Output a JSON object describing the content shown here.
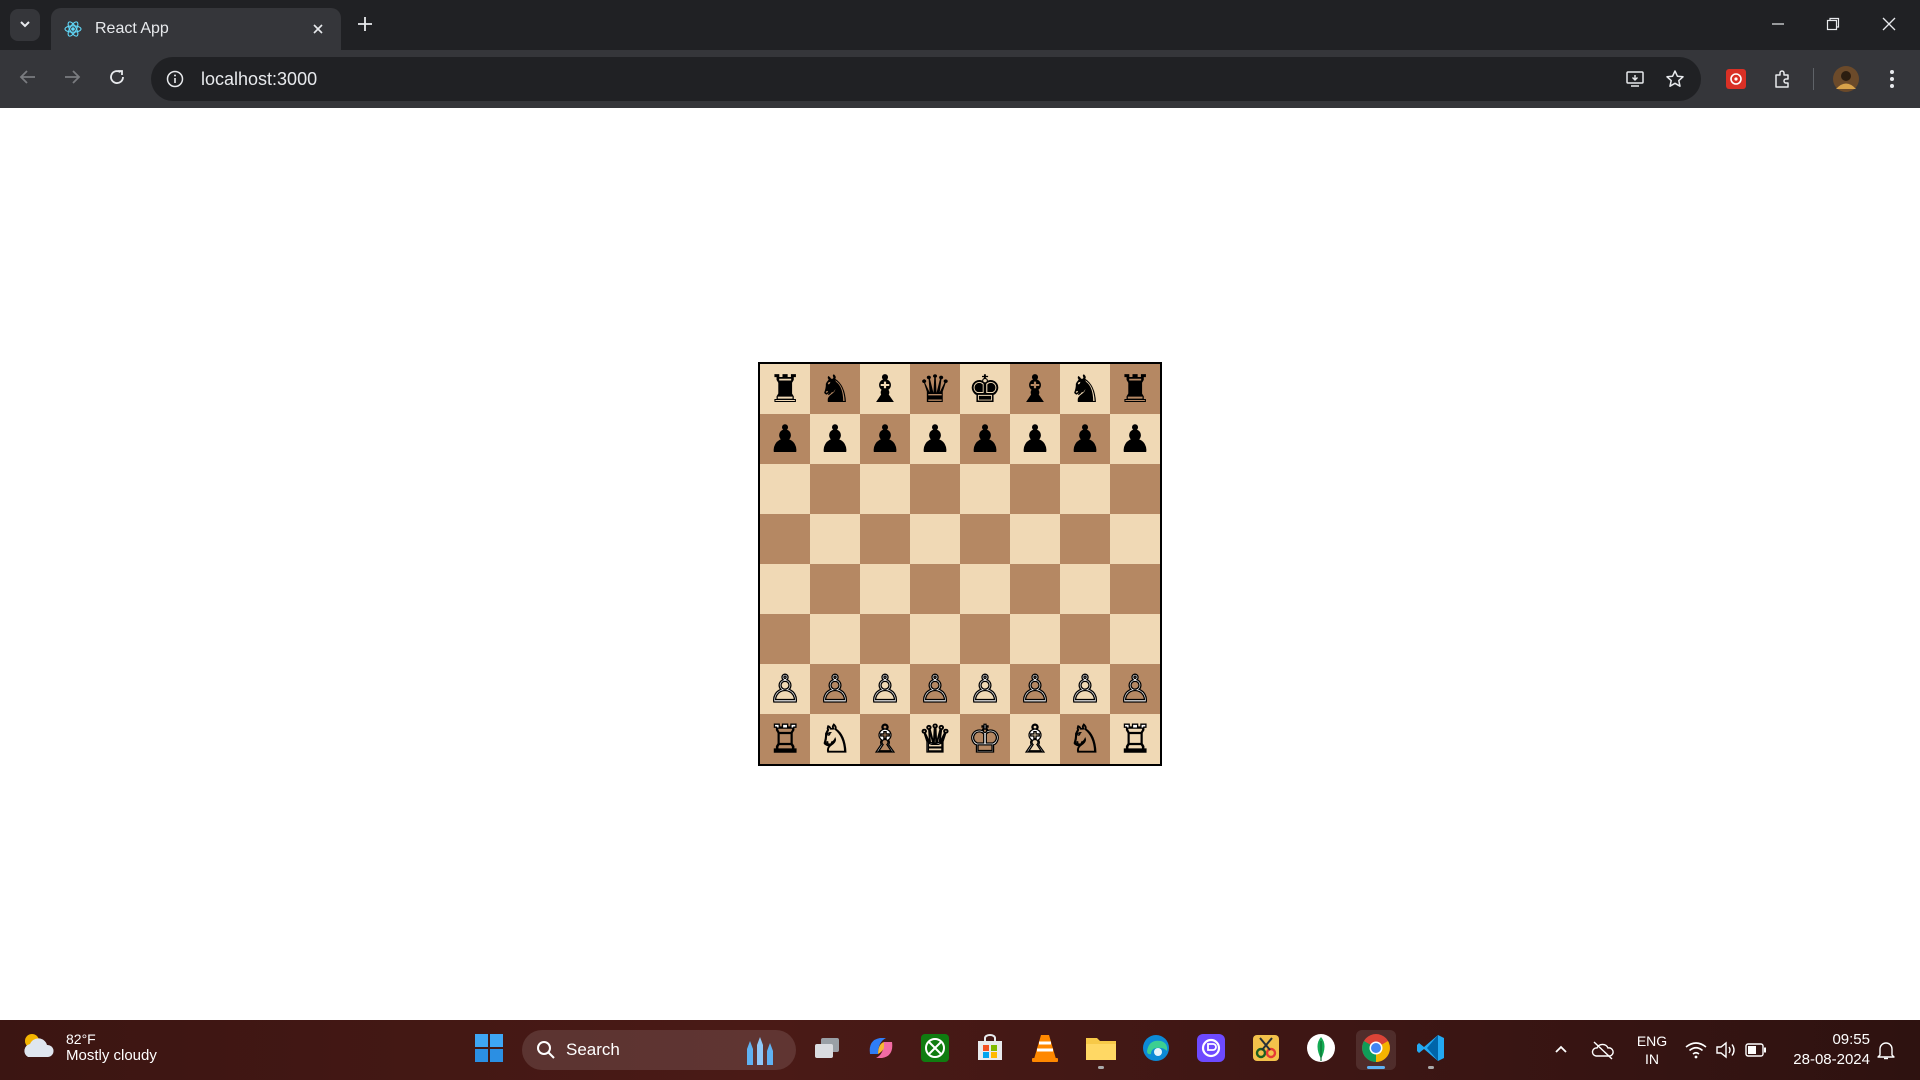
{
  "browser": {
    "tab": {
      "title": "React App",
      "favicon": "react-icon"
    },
    "address": {
      "url": "localhost:3000"
    }
  },
  "board": {
    "light_color": "#f0d9b5",
    "dark_color": "#b58863",
    "rows": [
      [
        "♜",
        "♞",
        "♝",
        "♛",
        "♚",
        "♝",
        "♞",
        "♜"
      ],
      [
        "♟",
        "♟",
        "♟",
        "♟",
        "♟",
        "♟",
        "♟",
        "♟"
      ],
      [
        "",
        "",
        "",
        "",
        "",
        "",
        "",
        ""
      ],
      [
        "",
        "",
        "",
        "",
        "",
        "",
        "",
        ""
      ],
      [
        "",
        "",
        "",
        "",
        "",
        "",
        "",
        ""
      ],
      [
        "",
        "",
        "",
        "",
        "",
        "",
        "",
        ""
      ],
      [
        "♙",
        "♙",
        "♙",
        "♙",
        "♙",
        "♙",
        "♙",
        "♙"
      ],
      [
        "♖",
        "♘",
        "♗",
        "♕",
        "♔",
        "♗",
        "♘",
        "♖"
      ]
    ]
  },
  "taskbar": {
    "weather": {
      "temp": "82°F",
      "desc": "Mostly cloudy"
    },
    "search_label": "Search",
    "language": {
      "line1": "ENG",
      "line2": "IN"
    },
    "clock": {
      "time": "09:55",
      "date": "28-08-2024"
    }
  }
}
